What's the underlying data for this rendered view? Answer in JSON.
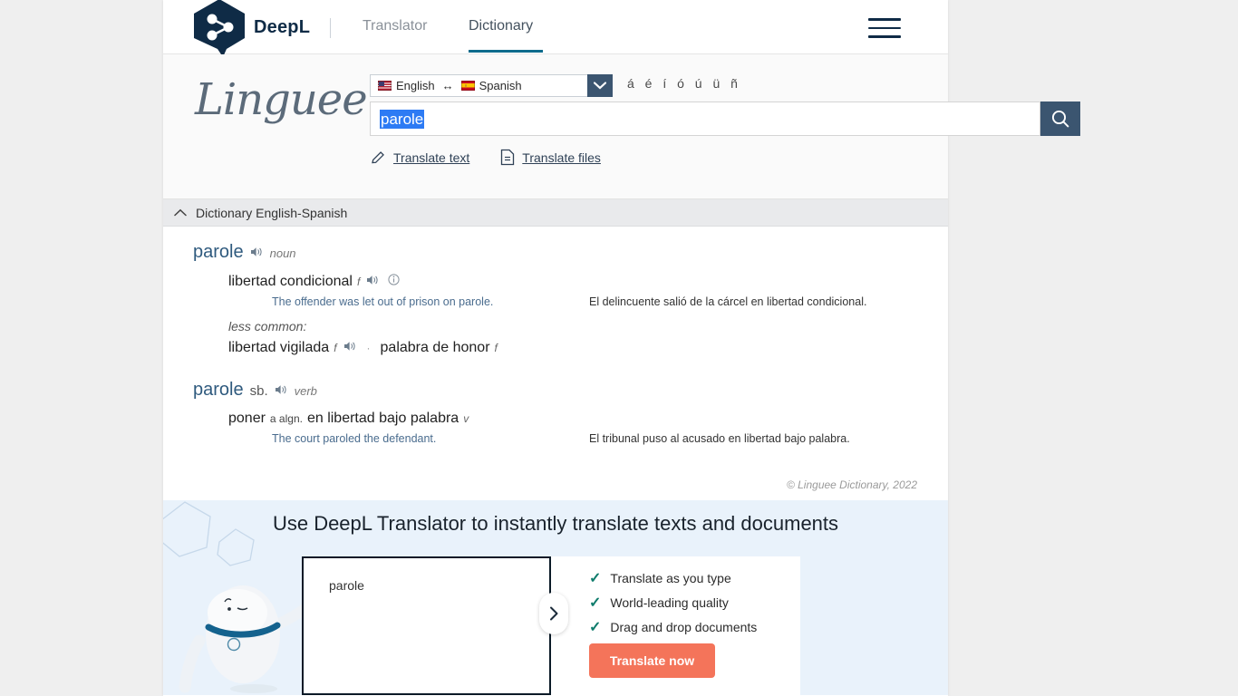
{
  "topnav": {
    "brand": "DeepL",
    "items": [
      {
        "label": "Translator",
        "active": false
      },
      {
        "label": "Dictionary",
        "active": true
      }
    ],
    "menu_icon": "hamburger-menu-icon",
    "logo_icon": "deepl-logo-icon"
  },
  "search": {
    "site_logo": "Linguee",
    "language_pair": {
      "source": "English",
      "source_flag": "us-flag-icon",
      "swap": "↔",
      "target": "Spanish",
      "target_flag": "es-flag-icon",
      "caret_icon": "chevron-down-icon"
    },
    "accents": "á é í ó ú ü ñ",
    "query": "parole",
    "placeholder": "",
    "search_icon": "magnifier-icon",
    "links": [
      {
        "label": "Translate text",
        "icon": "pencil-icon"
      },
      {
        "label": "Translate files",
        "icon": "document-icon"
      }
    ]
  },
  "dictionary": {
    "header": "Dictionary English-Spanish",
    "collapse_icon": "chevron-up-icon",
    "entries": [
      {
        "headword": "parole",
        "sub": "",
        "audio_icon": "speaker-icon",
        "pos": "noun",
        "translations": [
          {
            "term": "libertad condicional",
            "gender": "f",
            "audio": "speaker-icon",
            "info": "info-icon"
          }
        ],
        "example": {
          "source": "The offender was let out of prison on parole.",
          "target": "El delincuente salió de la cárcel en libertad condicional."
        },
        "less_common_label": "less common:",
        "less_common": [
          {
            "term": "libertad vigilada",
            "gender": "f",
            "audio": "speaker-icon"
          },
          {
            "term": "palabra de honor",
            "gender": "f",
            "audio": ""
          }
        ],
        "separator": "·"
      },
      {
        "headword": "parole",
        "sub": "sb.",
        "audio_icon": "speaker-icon",
        "pos": "verb",
        "translations": [
          {
            "term": "poner",
            "small": "a algn.",
            "rest": "en libertad bajo palabra",
            "gender": "v"
          }
        ],
        "example": {
          "source": "The court paroled the defendant.",
          "target": "El tribunal puso al acusado en libertad bajo palabra."
        }
      }
    ],
    "copyright": "© Linguee Dictionary, 2022"
  },
  "promo": {
    "title": "Use DeepL Translator to instantly translate texts and documents",
    "input_text": "parole",
    "swap_icon": "chevron-right-icon",
    "features": [
      "Translate as you type",
      "World-leading quality",
      "Drag and drop documents"
    ],
    "check_icon": "check-icon",
    "cta": "Translate now",
    "mascot_icon": "robot-mascot-illustration"
  },
  "colors": {
    "brand_dark": "#0f2b46",
    "accent_blue": "#0e6b8c",
    "selection_blue": "#2d7bf4",
    "cta_orange": "#f4745a",
    "check_green": "#0f7c6c",
    "promo_bg": "#e9f2fb",
    "page_bg": "#efefef"
  }
}
